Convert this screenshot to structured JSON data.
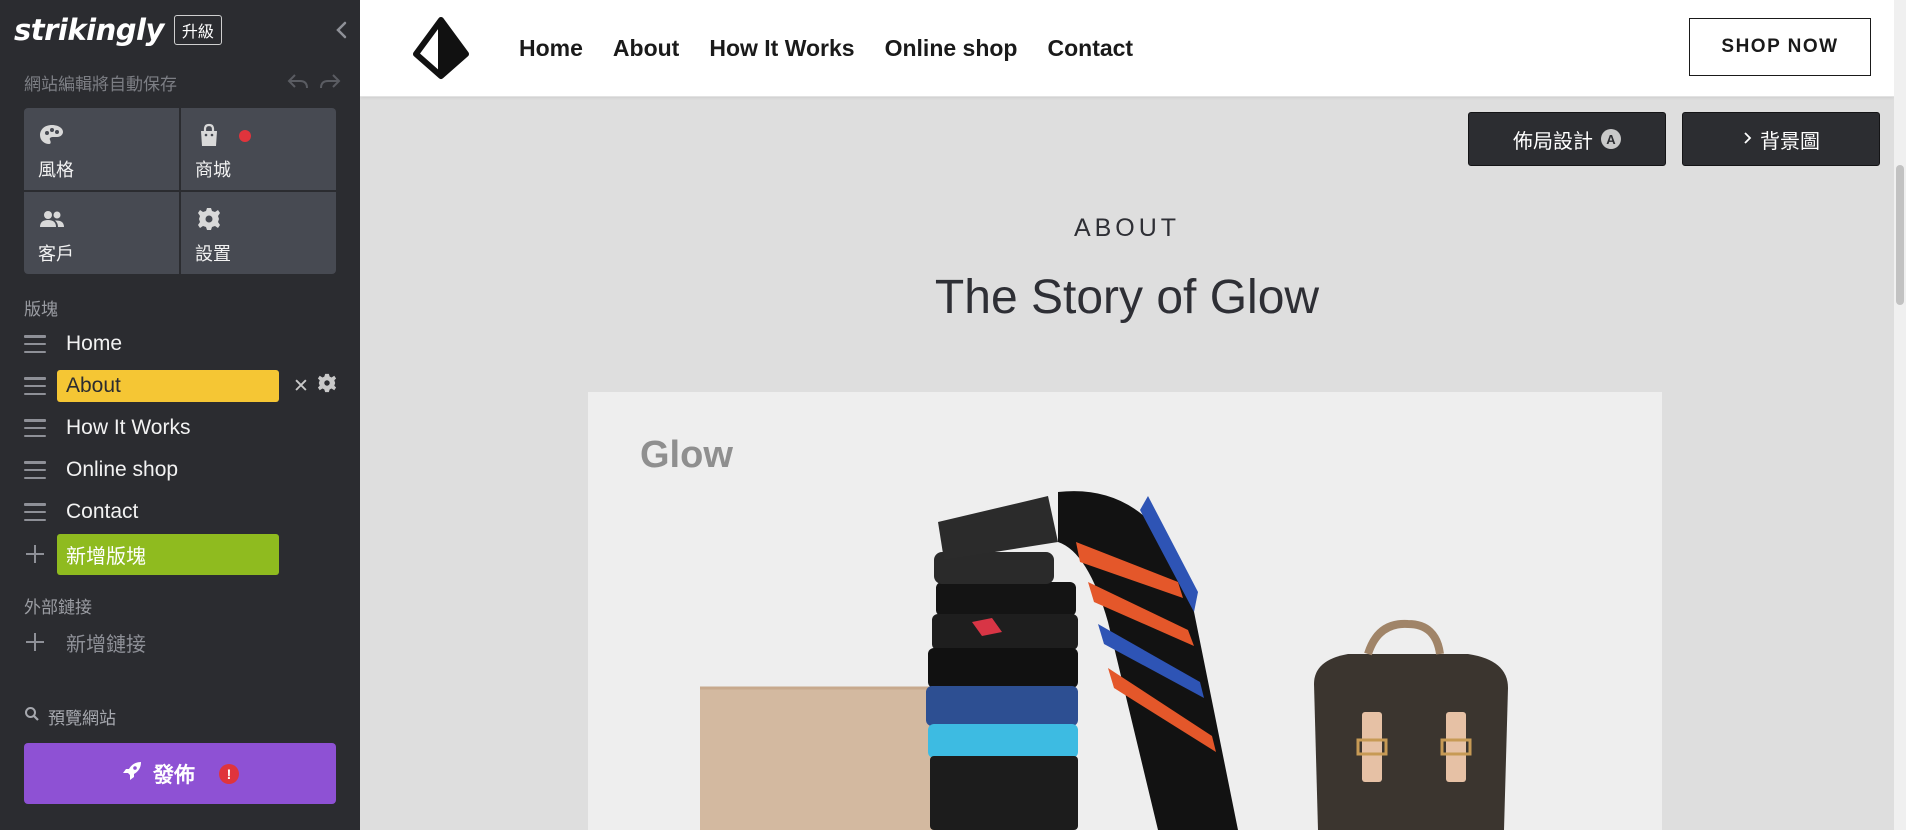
{
  "editor": {
    "brand": "strikingly",
    "upgrade_label": "升級",
    "autosave_text": "網站編輯將自動保存",
    "tiles": [
      {
        "label": "風格",
        "icon": "palette-icon"
      },
      {
        "label": "商城",
        "icon": "shopping-bag-icon"
      },
      {
        "label": "客戶",
        "icon": "users-icon"
      },
      {
        "label": "設置",
        "icon": "gear-icon"
      }
    ],
    "sections_label": "版塊",
    "sections": [
      {
        "label": "Home"
      },
      {
        "label": "About",
        "active": true
      },
      {
        "label": "How It Works"
      },
      {
        "label": "Online shop"
      },
      {
        "label": "Contact"
      }
    ],
    "add_section_label": "新增版塊",
    "external_links_label": "外部鏈接",
    "add_link_label": "新增鏈接",
    "preview_label": "預覽網站",
    "publish_label": "發佈",
    "publish_alert": "!",
    "colors": {
      "sidebar_bg": "#2b2c30",
      "tile_bg": "#474a52",
      "active_section": "#f5c634",
      "add_section": "#8fbb1f",
      "publish": "#8e51d4",
      "alert": "#e0343c"
    }
  },
  "site": {
    "nav": [
      "Home",
      "About",
      "How It Works",
      "Online shop",
      "Contact"
    ],
    "shop_now_label": "SHOP NOW",
    "layout_button_label": "佈局設計",
    "layout_badge": "A",
    "background_button_label": "背景圖",
    "about_eyebrow": "ABOUT",
    "about_title": "The Story of Glow",
    "photo_brand": "Glow"
  }
}
